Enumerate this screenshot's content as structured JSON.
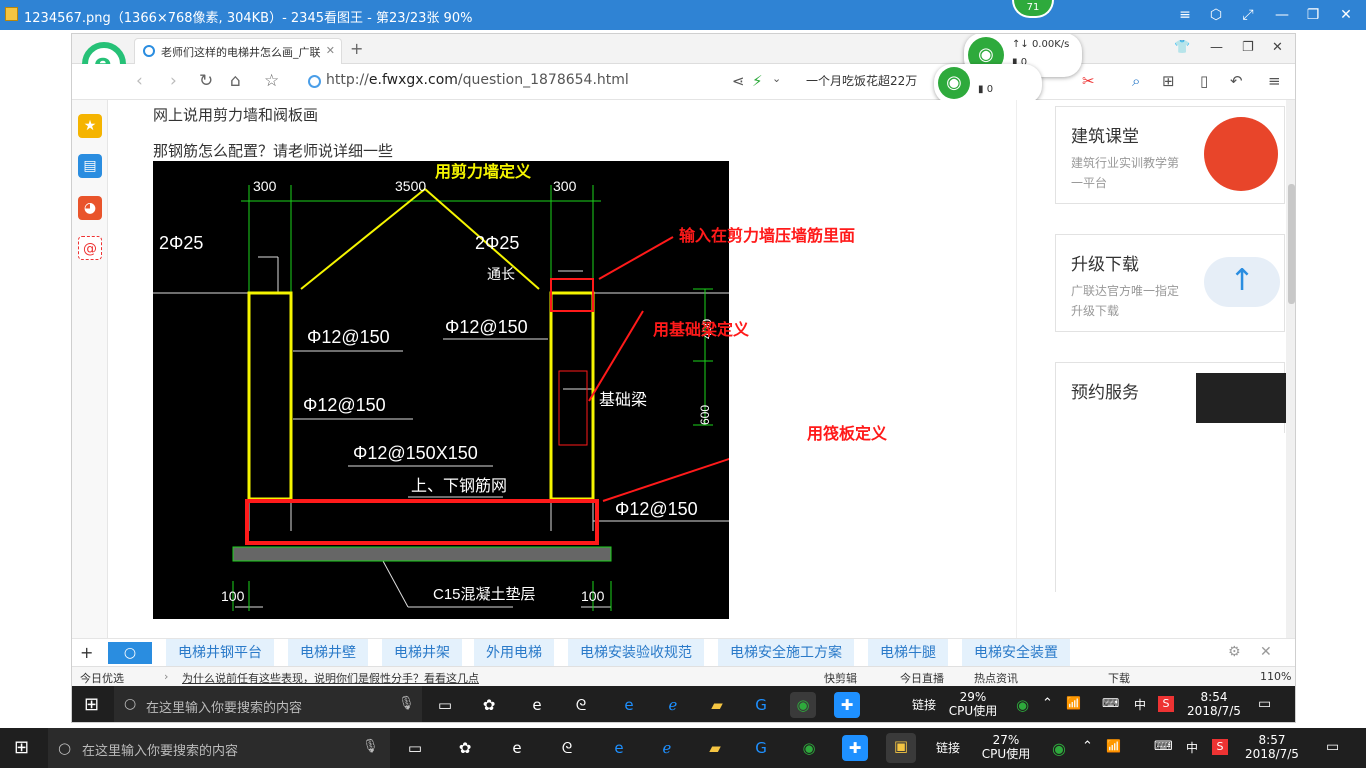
{
  "viewer": {
    "title": "1234567.png（1366×768像素, 304KB）- 2345看图王 - 第23/23张 90%",
    "badge": "71",
    "controls": [
      "≡",
      "⬡",
      "⤢",
      "—",
      "❐",
      "✕"
    ]
  },
  "browser": {
    "tab_title": "老师们这样的电梯井怎么画_广联",
    "new_tab": "+",
    "window_controls": [
      "👕",
      "—",
      "❐",
      "✕"
    ],
    "url_host": "e.fwxgx.com",
    "url_prefix": "http://",
    "url_path": "/question_1878654.html",
    "headline": "一个月吃饭花超22万",
    "wifi_speed": "0.00K/s",
    "wifi_count": "0",
    "wifi_count2": "0"
  },
  "content": {
    "line1": "网上说用剪力墙和阀板画",
    "line2": "那钢筋怎么配置？请老师说详细一些"
  },
  "drawing": {
    "dims": [
      "300",
      "3500",
      "300",
      "100",
      "100",
      "400",
      "600"
    ],
    "labels": [
      "2Φ25",
      "2Φ25",
      "通长",
      "Φ12@150",
      "Φ12@150",
      "Φ12@150",
      "Φ12@150X150",
      "上、下钢筋网",
      "基础梁",
      "Φ12@150",
      "C15混凝土垫层"
    ],
    "annotations": [
      "用剪力墙定义",
      "输入在剪力墙压墙筋里面",
      "用基础梁定义",
      "用筏板定义"
    ]
  },
  "sidebar_cards": [
    {
      "title": "建筑课堂",
      "sub": "建筑行业实训教学第一平台"
    },
    {
      "title": "升级下载",
      "sub": "广联达官方唯一指定升级下载"
    },
    {
      "title": "预约服务",
      "sub": ""
    }
  ],
  "keywords": [
    "电梯井钢平台",
    "电梯井壁",
    "电梯井架",
    "外用电梯",
    "电梯安装验收规范",
    "电梯安全施工方案",
    "电梯牛腿",
    "电梯安全装置"
  ],
  "status": {
    "left": "今日优选",
    "news": "为什么说前任有这些表现，说明你们是假性分手？看看这几点",
    "items": [
      "快剪辑",
      "今日直播",
      "热点资讯",
      "下载"
    ],
    "zoom": "110%"
  },
  "inner_taskbar": {
    "search": "在这里输入你要搜索的内容",
    "link": "链接",
    "cpu": "29%",
    "cpu_label": "CPU使用",
    "ime": "中",
    "time": "8:54",
    "date": "2018/7/5"
  },
  "outer_taskbar": {
    "search": "在这里输入你要搜索的内容",
    "link": "链接",
    "cpu": "27%",
    "cpu_label": "CPU使用",
    "ime": "中",
    "time": "8:57",
    "date": "2018/7/5"
  }
}
